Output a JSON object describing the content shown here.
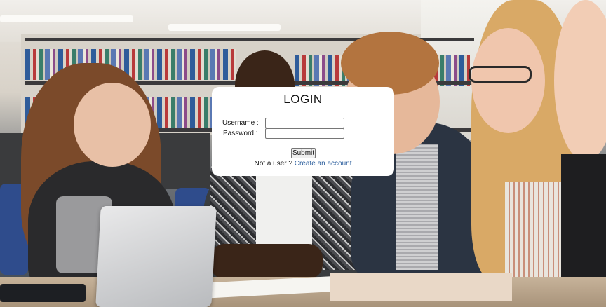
{
  "login": {
    "title": "LOGIN",
    "username_label": "Username :",
    "username_value": "",
    "password_label": "Password :",
    "password_value": "",
    "submit_label": "Submit",
    "signup_prompt": "Not a user ?",
    "signup_link": "Create an account"
  },
  "colors": {
    "card_background": "#ffffff",
    "link": "#2a5d9c",
    "button_background": "#efefef"
  }
}
